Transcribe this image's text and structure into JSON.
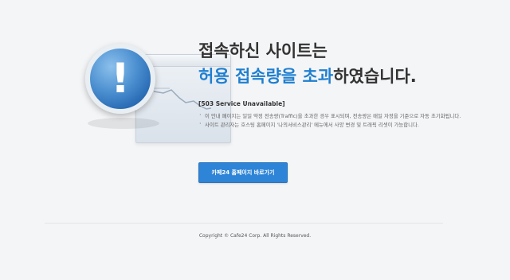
{
  "title": {
    "line1": "접속하신 사이트는",
    "line2_highlight1": "허용 접속량을 초과",
    "line2_rest": "하였습니다."
  },
  "status": "[503 Service Unavailable]",
  "description": [
    "이 안내 페이지는 일일 약정 전송량(Traffic)을 초과한 경우 표시되며, 전송량은 매일 자정을 기준으로 자동 초기화됩니다.",
    "사이트 관리자는 호스팅 홈페이지 '나의서비스관리' 메뉴에서 사양 변경 및 트래픽 리셋이 가능합니다."
  ],
  "button_label": "카페24 홈페이지 바로가기",
  "footer": "Copyright © Cafe24 Corp. All Rights Reserved.",
  "icons": {
    "alert": "exclamation-icon",
    "browser": "browser-window-icon"
  },
  "colors": {
    "accent": "#1f7fd0",
    "button": "#2e84d6",
    "background": "#f4f5f7"
  }
}
